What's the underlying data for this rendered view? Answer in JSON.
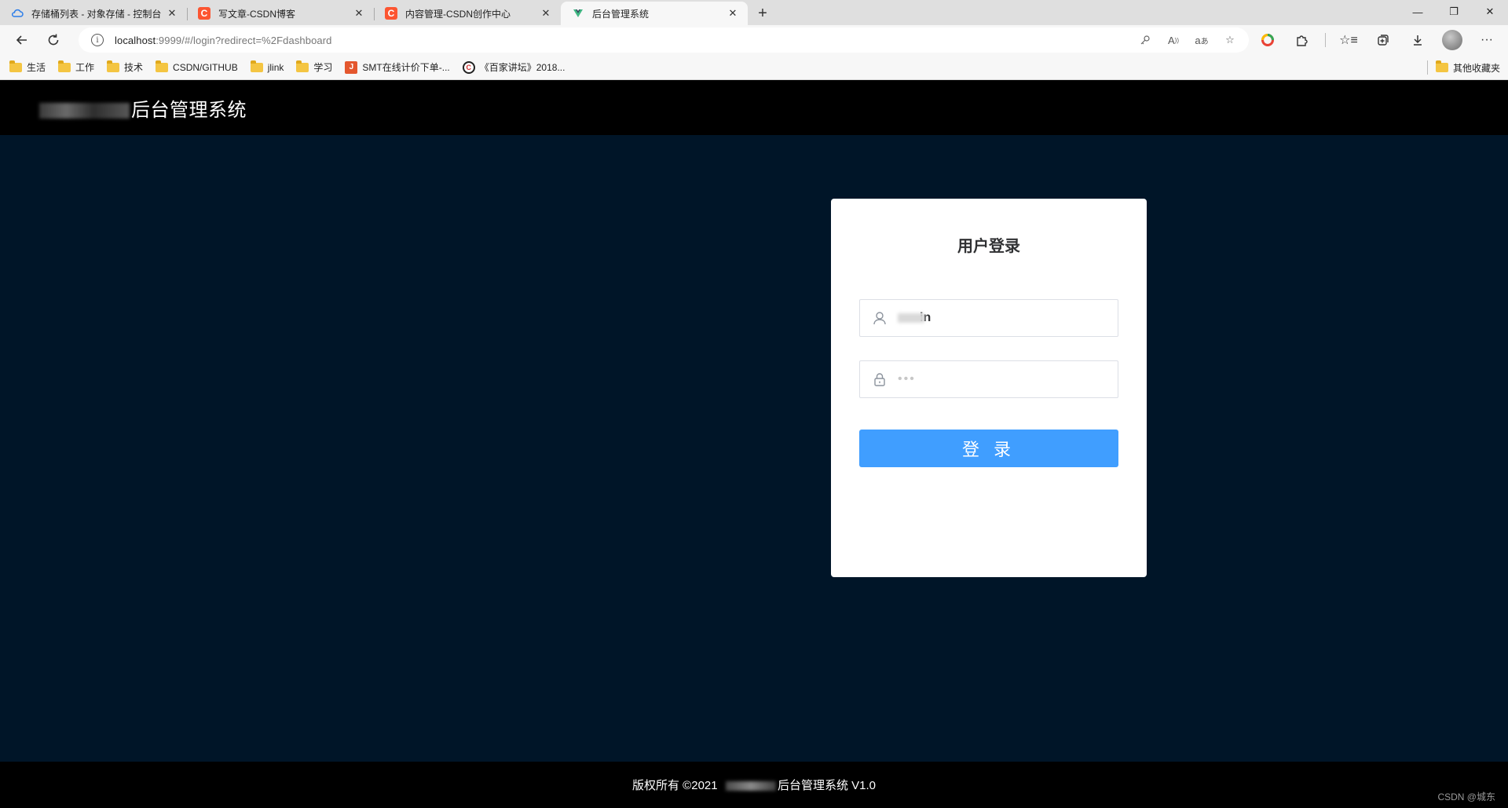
{
  "browser": {
    "tabs": [
      {
        "title": "存储桶列表 - 对象存储 - 控制台",
        "icon": "cloud-icon",
        "active": false
      },
      {
        "title": "写文章-CSDN博客",
        "icon": "csdn-icon",
        "active": false
      },
      {
        "title": "内容管理-CSDN创作中心",
        "icon": "csdn-icon",
        "active": false
      },
      {
        "title": "后台管理系统",
        "icon": "leaf-icon",
        "active": true
      }
    ],
    "url_host": "localhost",
    "url_rest": ":9999/#/login?redirect=%2Fdashboard",
    "bookmarks": [
      {
        "label": "生活",
        "icon": "folder-icon"
      },
      {
        "label": "工作",
        "icon": "folder-icon"
      },
      {
        "label": "技术",
        "icon": "folder-icon"
      },
      {
        "label": "CSDN/GITHUB",
        "icon": "folder-icon"
      },
      {
        "label": "jlink",
        "icon": "folder-icon"
      },
      {
        "label": "学习",
        "icon": "folder-icon"
      },
      {
        "label": "SMT在线计价下单-...",
        "icon": "smt-icon"
      },
      {
        "label": "《百家讲坛》2018...",
        "icon": "cctv-icon"
      }
    ],
    "other_favorites": "其他收藏夹"
  },
  "header": {
    "title_suffix": "后台管理系统"
  },
  "login": {
    "title": "用户登录",
    "username_visible": "in",
    "password_mask": "•••",
    "button_label": "登 录"
  },
  "footer": {
    "prefix": "版权所有 ©2021",
    "suffix": "后台管理系统 V1.0"
  },
  "watermark": "CSDN @城东",
  "colors": {
    "page_bg": "#001528",
    "header_bg": "#000000",
    "primary": "#409eff"
  }
}
